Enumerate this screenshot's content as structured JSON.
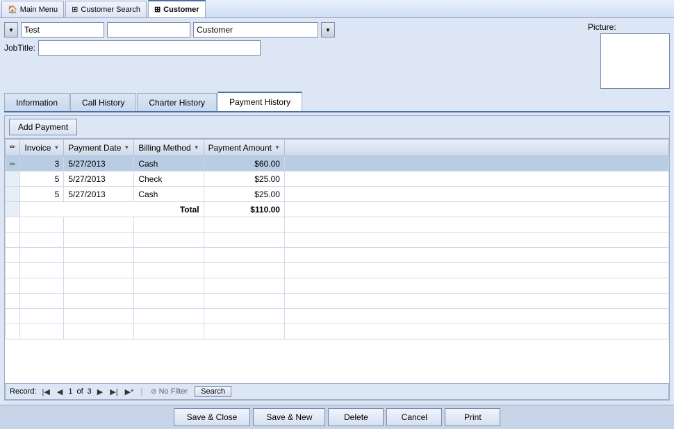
{
  "titlebar": {
    "tabs": [
      {
        "id": "main-menu",
        "label": "Main Menu",
        "icon": "home",
        "active": false
      },
      {
        "id": "customer-search",
        "label": "Customer Search",
        "icon": "grid",
        "active": false
      },
      {
        "id": "customer",
        "label": "Customer",
        "icon": "grid",
        "active": true
      }
    ]
  },
  "form": {
    "first_name_value": "Test",
    "last_name_value": "Customer",
    "jobtitle_label": "JobTitle:",
    "jobtitle_value": "",
    "picture_label": "Picture:"
  },
  "inner_tabs": [
    {
      "id": "information",
      "label": "Information",
      "active": false
    },
    {
      "id": "call-history",
      "label": "Call History",
      "active": false
    },
    {
      "id": "charter-history",
      "label": "Charter History",
      "active": false
    },
    {
      "id": "payment-history",
      "label": "Payment History",
      "active": true
    }
  ],
  "add_payment_btn": "Add Payment",
  "table": {
    "columns": [
      {
        "id": "invoice",
        "label": "Invoice"
      },
      {
        "id": "payment-date",
        "label": "Payment Date"
      },
      {
        "id": "billing-method",
        "label": "Billing Method"
      },
      {
        "id": "payment-amount",
        "label": "Payment Amount"
      }
    ],
    "rows": [
      {
        "invoice": "3",
        "payment_date": "5/27/2013",
        "billing_method": "Cash",
        "payment_amount": "$60.00",
        "highlighted": true
      },
      {
        "invoice": "5",
        "payment_date": "5/27/2013",
        "billing_method": "Check",
        "payment_amount": "$25.00",
        "highlighted": false
      },
      {
        "invoice": "5",
        "payment_date": "5/27/2013",
        "billing_method": "Cash",
        "payment_amount": "$25.00",
        "highlighted": false
      }
    ],
    "total_label": "Total",
    "total_value": "$110.00"
  },
  "status_bar": {
    "record_label": "Record:",
    "record_current": "1",
    "record_of": "of",
    "record_total": "3",
    "filter_label": "No Filter",
    "search_label": "Search"
  },
  "action_bar": {
    "save_close": "Save & Close",
    "save_new": "Save & New",
    "delete": "Delete",
    "cancel": "Cancel",
    "print": "Print"
  }
}
